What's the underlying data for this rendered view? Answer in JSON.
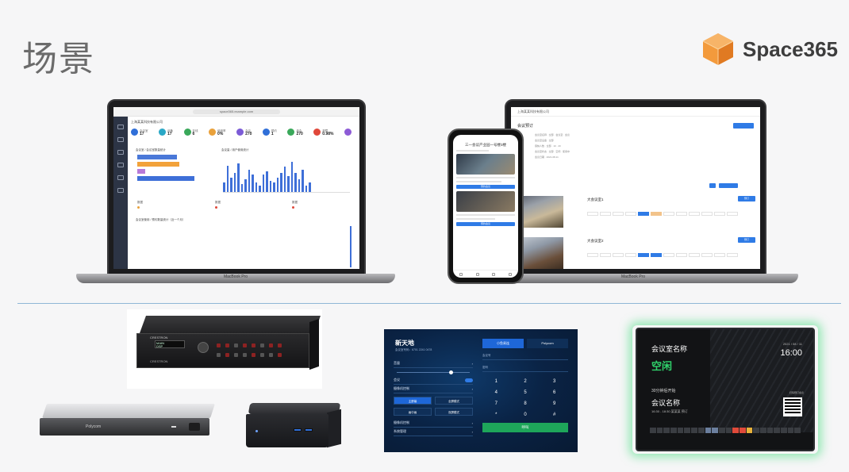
{
  "header": {
    "title": "场景",
    "brand": "Space365"
  },
  "dashboard": {
    "device_label": "MacBook Pro",
    "kpis": [
      {
        "label": "会议室",
        "value": "17",
        "color": "#2f6fd8"
      },
      {
        "label": "设备",
        "value": "17",
        "color": "#2ba8c6"
      },
      {
        "label": "在线",
        "value": "6",
        "color": "#3aa85a"
      },
      {
        "label": "使用率",
        "value": "0%",
        "color": "#e9a13b"
      },
      {
        "label": "会议",
        "value": "270",
        "color": "#7b5bd6"
      },
      {
        "label": "预约",
        "value": "1",
        "color": "#2f6fd8"
      },
      {
        "label": "参会",
        "value": "270",
        "color": "#3aa85a"
      },
      {
        "label": "故障",
        "value": "0.98%",
        "color": "#e0483a"
      },
      {
        "label": "",
        "value": "",
        "color": "#8d5bd6"
      }
    ],
    "bar_panel_title": "会议室 / 会议室数量统计",
    "column_panel_title": "会议量 / 用户使用统计",
    "bottom_panel_title": "会议室使用 / 预约数量统计（近一个月）",
    "hbar_colors": [
      "#4a78d8",
      "#f2a23a",
      "#b77ad8",
      "#3e6fd8"
    ],
    "hbar_widths": [
      0.62,
      0.66,
      0.12,
      0.9
    ],
    "vbar_heights": [
      0.3,
      0.82,
      0.45,
      0.6,
      0.9,
      0.25,
      0.4,
      0.7,
      0.55,
      0.3,
      0.2,
      0.55,
      0.65,
      0.35,
      0.3,
      0.45,
      0.6,
      0.8,
      0.5,
      0.95,
      0.6,
      0.4,
      0.7,
      0.2,
      0.3
    ]
  },
  "phone": {
    "title": "三一会议产业园一号楼3楼",
    "button": "预约会议"
  },
  "booking": {
    "page_title": "会议预订",
    "device_label": "MacBook Pro",
    "room1": "大会议室1",
    "room2": "大会议室2",
    "action": "预订"
  },
  "touch_panel": {
    "title": "新天地",
    "subtitle": "会议室号码：6701 2241 0478",
    "brands": [
      "小鱼易连",
      "Polycom"
    ],
    "left_rows": [
      "音量",
      "会议",
      "摄像机控制"
    ],
    "tabs": [
      "主屏幕",
      "全屏模式",
      "画中画",
      "双屏模式"
    ],
    "bottom_rows": [
      "摄像机控制",
      "系统管理"
    ],
    "field1": "会议号",
    "field2": "密码",
    "keys": [
      "1",
      "2",
      "3",
      "4",
      "5",
      "6",
      "7",
      "8",
      "9",
      "*",
      "0",
      "#"
    ],
    "call": "呼叫"
  },
  "door_panel": {
    "room_name": "会议室名称",
    "status": "空闲",
    "date": "2021 / 08 / 11",
    "time": "16:00",
    "next_label": "30分钟后开始",
    "meeting_name": "会议名称",
    "meeting_time": "16:30 - 18:30  某某某 预订",
    "qr_label": "扫码预订会议"
  }
}
